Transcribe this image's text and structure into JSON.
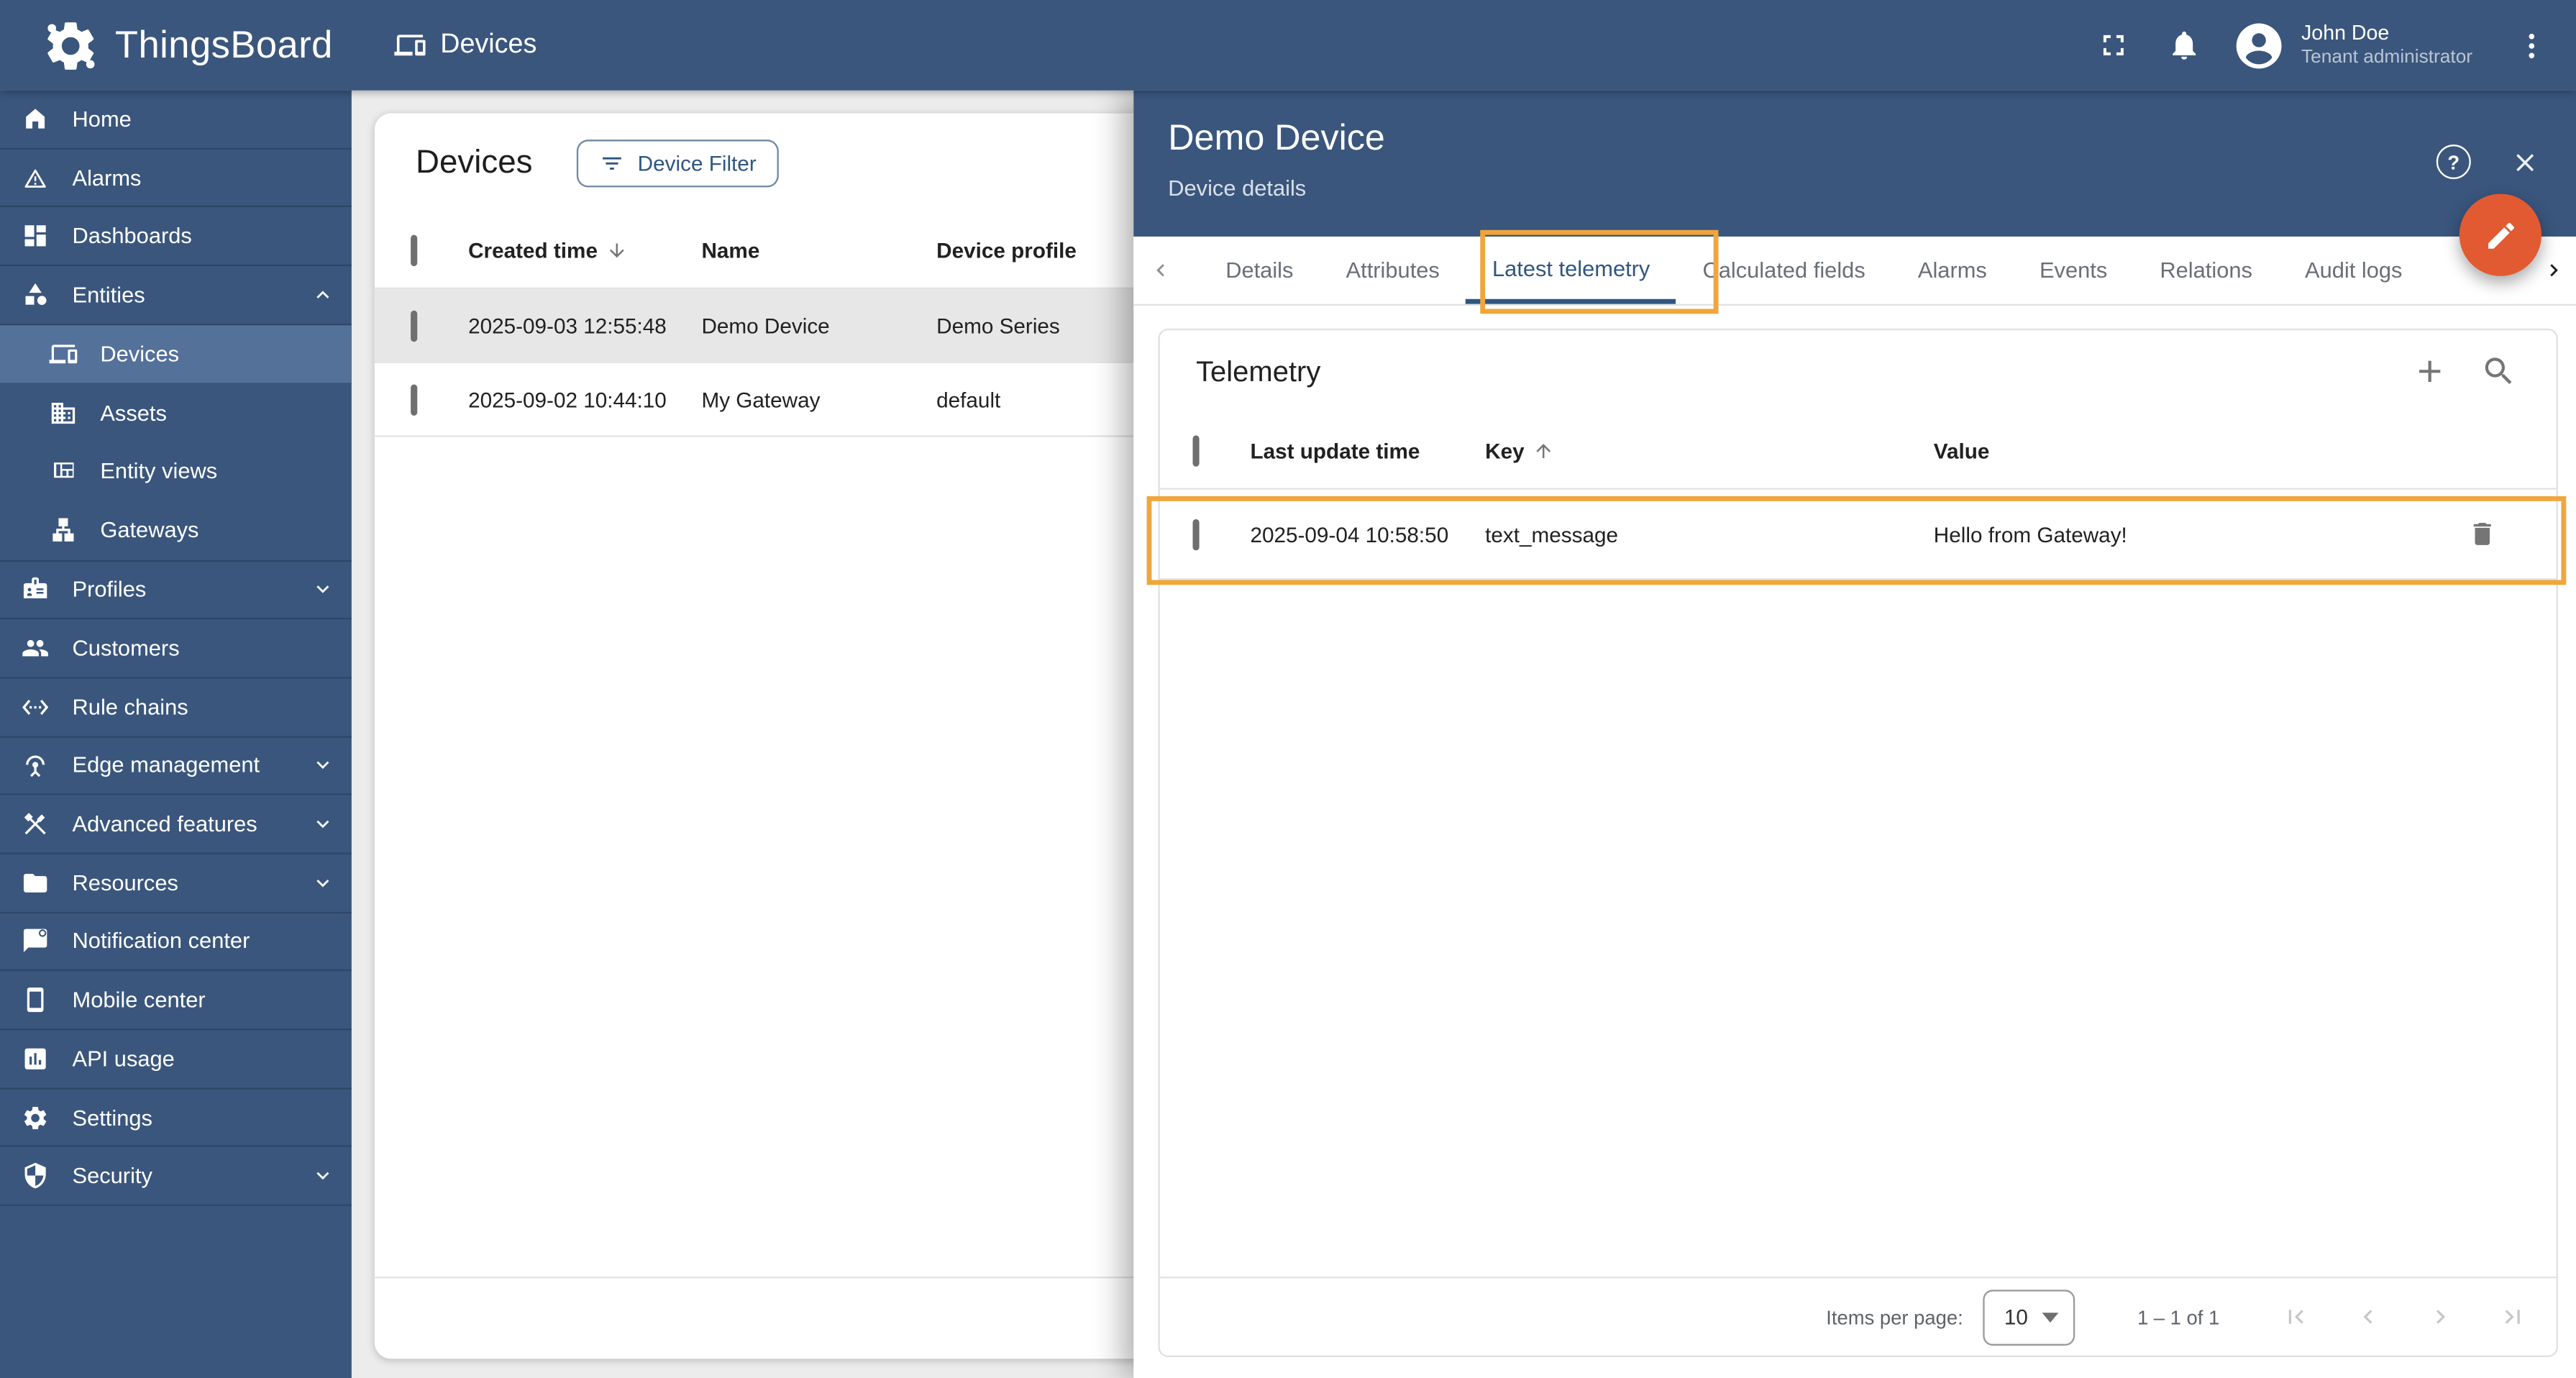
{
  "app": {
    "brand": "ThingsBoard",
    "page_title": "Devices"
  },
  "topbar": {
    "user_name": "John Doe",
    "user_role": "Tenant administrator",
    "icons": [
      "fullscreen-icon",
      "notifications-bell-icon",
      "account-circle-icon",
      "more-vert-icon"
    ]
  },
  "sidebar": {
    "items": [
      {
        "label": "Home",
        "icon": "home-icon"
      },
      {
        "label": "Alarms",
        "icon": "warning-icon"
      },
      {
        "label": "Dashboards",
        "icon": "dashboard-icon"
      },
      {
        "label": "Entities",
        "icon": "category-icon",
        "expanded": true
      },
      {
        "label": "Devices",
        "icon": "devices-icon",
        "sub": true,
        "selected": true
      },
      {
        "label": "Assets",
        "icon": "building-icon",
        "sub": true
      },
      {
        "label": "Entity views",
        "icon": "view-quilt-icon",
        "sub": true
      },
      {
        "label": "Gateways",
        "icon": "lan-icon",
        "sub": true
      },
      {
        "label": "Profiles",
        "icon": "badge-icon",
        "expandable": true
      },
      {
        "label": "Customers",
        "icon": "people-icon"
      },
      {
        "label": "Rule chains",
        "icon": "settings-ethernet-icon"
      },
      {
        "label": "Edge management",
        "icon": "antenna-icon",
        "expandable": true
      },
      {
        "label": "Advanced features",
        "icon": "tools-icon",
        "expandable": true
      },
      {
        "label": "Resources",
        "icon": "folder-icon",
        "expandable": true
      },
      {
        "label": "Notification center",
        "icon": "notification-message-icon"
      },
      {
        "label": "Mobile center",
        "icon": "smartphone-icon"
      },
      {
        "label": "API usage",
        "icon": "chart-icon"
      },
      {
        "label": "Settings",
        "icon": "gear-icon"
      },
      {
        "label": "Security",
        "icon": "shield-icon",
        "expandable": true
      }
    ]
  },
  "devices_panel": {
    "title": "Devices",
    "filter_button": "Device Filter",
    "columns": {
      "created": "Created time",
      "name": "Name",
      "profile": "Device profile"
    },
    "sort_column": "Created time",
    "sort_direction": "desc",
    "rows": [
      {
        "created": "2025-09-03 12:55:48",
        "name": "Demo Device",
        "profile": "Demo Series",
        "selected": true
      },
      {
        "created": "2025-09-02 10:44:10",
        "name": "My Gateway",
        "profile": "default",
        "selected": false
      }
    ]
  },
  "drawer": {
    "title": "Demo Device",
    "subtitle": "Device details",
    "help_glyph": "?",
    "tabs": [
      "Details",
      "Attributes",
      "Latest telemetry",
      "Calculated fields",
      "Alarms",
      "Events",
      "Relations",
      "Audit logs"
    ],
    "active_tab": "Latest telemetry",
    "telemetry": {
      "title": "Telemetry",
      "columns": {
        "time": "Last update time",
        "key": "Key",
        "value": "Value"
      },
      "sort_column": "Key",
      "sort_direction": "asc",
      "rows": [
        {
          "time": "2025-09-04 10:58:50",
          "key": "text_message",
          "value": "Hello from Gateway!"
        }
      ],
      "pagination": {
        "items_per_page_label": "Items per page:",
        "page_size": "10",
        "range": "1 – 1 of 1"
      }
    }
  },
  "annotations": [
    "highlight-latest-telemetry-tab",
    "highlight-telemetry-row"
  ],
  "colors": {
    "primary_blue": "#3a567d",
    "accent_text_blue": "#305680",
    "selected_nav": "#54719a",
    "fab_orange": "#e25a32",
    "annotation_orange": "#f0a63c",
    "selected_row_grey": "#e7e7e7",
    "background_grey": "#ececec",
    "divider": "#e3e3e3"
  }
}
